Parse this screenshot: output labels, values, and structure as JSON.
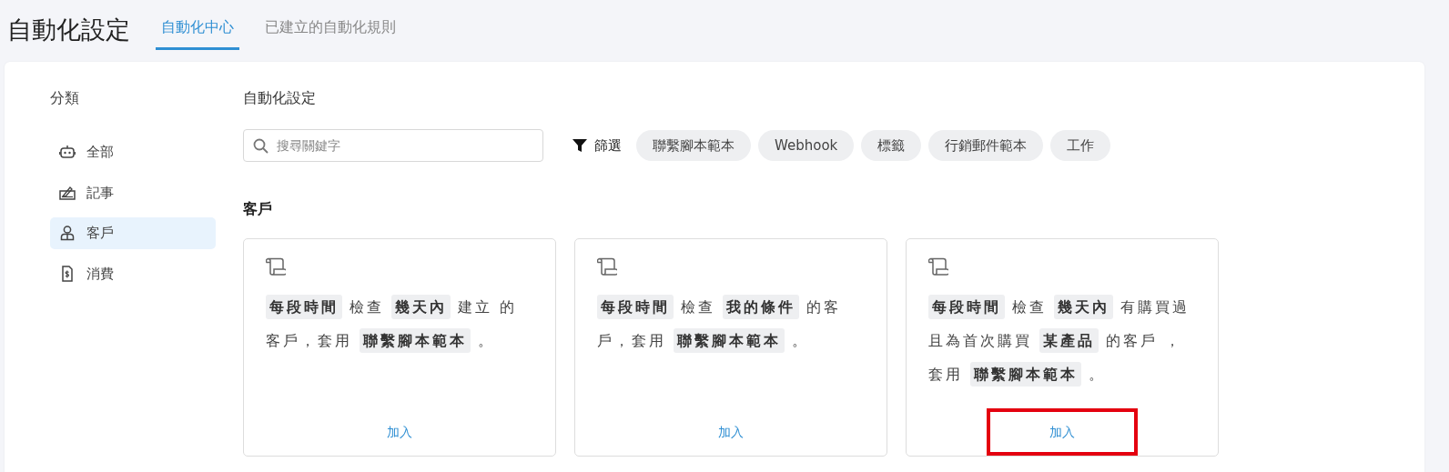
{
  "page_title": "自動化設定",
  "tabs": [
    {
      "label": "自動化中心",
      "selected": true
    },
    {
      "label": "已建立的自動化規則",
      "selected": false
    }
  ],
  "sidebar": {
    "title": "分類",
    "items": [
      {
        "label": "全部",
        "selected": false
      },
      {
        "label": "記事",
        "selected": false
      },
      {
        "label": "客戶",
        "selected": true
      },
      {
        "label": "消費",
        "selected": false
      }
    ]
  },
  "content": {
    "title": "自動化設定",
    "search": {
      "placeholder": "搜尋關鍵字"
    },
    "filter": {
      "label": "篩選",
      "chips": [
        "聯繫腳本範本",
        "Webhook",
        "標籤",
        "行銷郵件範本",
        "工作"
      ]
    },
    "section_title": "客戶",
    "cards": [
      {
        "description": "**每段時間** 檢查 **幾天內** 建立 的客戶，套用 **聯繫腳本範本** 。",
        "button": "加入",
        "highlighted": false
      },
      {
        "description": "**每段時間** 檢查 **我的條件** 的客戶，套用 **聯繫腳本範本** 。",
        "button": "加入",
        "highlighted": false
      },
      {
        "description": "**每段時間** 檢查 **幾天內** 有購買過且為首次購買 **某產品** 的客戶 ，套用 **聯繫腳本範本** 。",
        "button": "加入",
        "highlighted": true
      }
    ]
  }
}
